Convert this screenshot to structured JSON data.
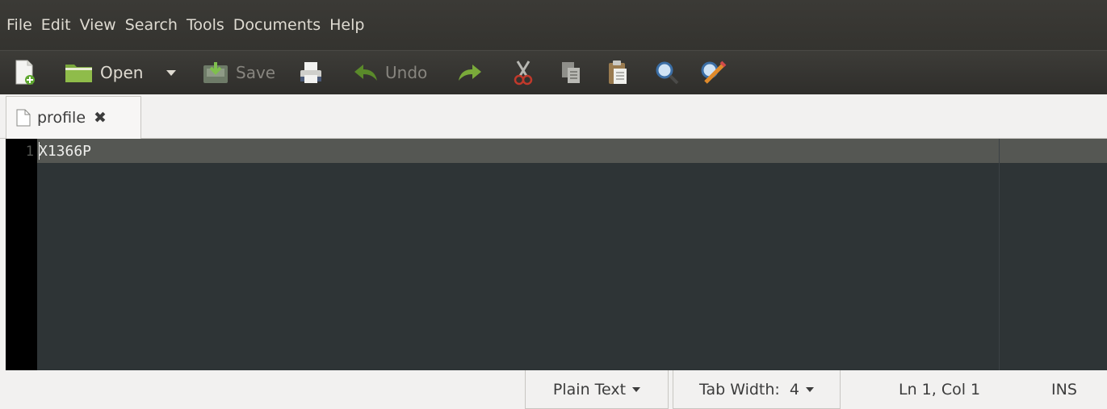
{
  "menu": [
    "File",
    "Edit",
    "View",
    "Search",
    "Tools",
    "Documents",
    "Help"
  ],
  "toolbar": {
    "open_label": "Open",
    "save_label": "Save",
    "undo_label": "Undo"
  },
  "tab": {
    "label": "profile"
  },
  "editor": {
    "lines": [
      {
        "number": "1",
        "text": "X1366P"
      }
    ]
  },
  "statusbar": {
    "language": "Plain Text",
    "tab_width": "Tab Width:  4",
    "position": "Ln 1, Col 1",
    "mode": "INS"
  },
  "colors": {
    "menubar_bg": "#3b3a36",
    "editor_bg": "#2e3436",
    "gutter_bg": "#000000",
    "current_line": "#555753"
  }
}
